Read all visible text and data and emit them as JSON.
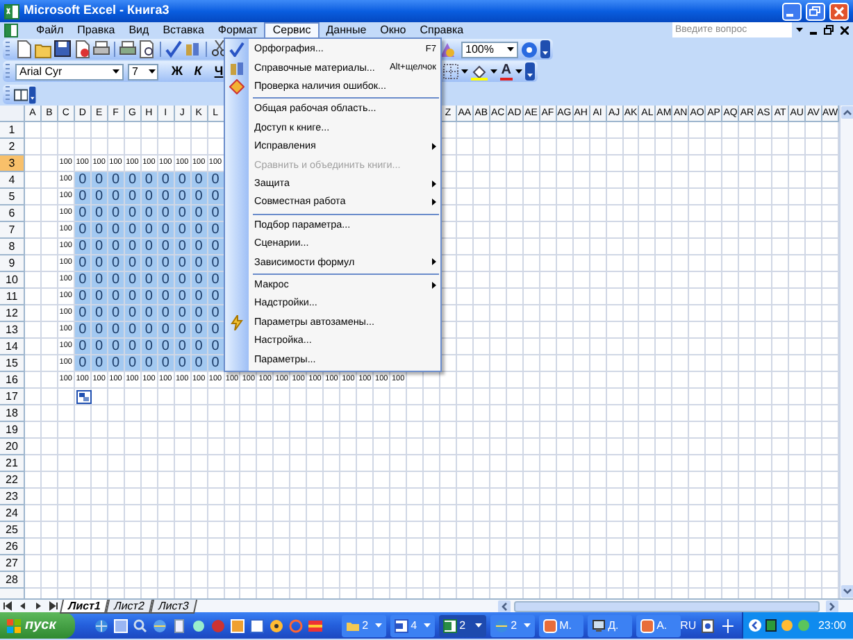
{
  "window": {
    "title": "Microsoft Excel - Книга3"
  },
  "menu_bar": [
    {
      "label": "Файл",
      "selected": false
    },
    {
      "label": "Правка",
      "selected": false
    },
    {
      "label": "Вид",
      "selected": false
    },
    {
      "label": "Вставка",
      "selected": false
    },
    {
      "label": "Формат",
      "selected": false
    },
    {
      "label": "Сервис",
      "selected": true
    },
    {
      "label": "Данные",
      "selected": false
    },
    {
      "label": "Окно",
      "selected": false
    },
    {
      "label": "Справка",
      "selected": false
    }
  ],
  "help_search": {
    "placeholder": "Введите вопрос"
  },
  "toolbar": {
    "zoom": "100%",
    "font": "Arial Cyr",
    "font_size": "7",
    "bold": "Ж",
    "italic": "К",
    "underline": "Ч",
    "font_color": "A"
  },
  "menu": [
    {
      "kind": "item",
      "label": "Орфография...",
      "shortcut": "F7",
      "submenu": false,
      "disabled": false
    },
    {
      "kind": "item",
      "label": "Справочные материалы...",
      "shortcut": "Alt+щелчок",
      "submenu": false,
      "disabled": false
    },
    {
      "kind": "item",
      "label": "Проверка наличия ошибок...",
      "submenu": false,
      "disabled": false
    },
    {
      "kind": "separator"
    },
    {
      "kind": "item",
      "label": "Общая рабочая область...",
      "submenu": false,
      "disabled": false
    },
    {
      "kind": "item",
      "label": "Доступ к книге...",
      "submenu": false,
      "disabled": false
    },
    {
      "kind": "item",
      "label": "Исправления",
      "submenu": true,
      "disabled": false
    },
    {
      "kind": "item",
      "label": "Сравнить и объединить книги...",
      "submenu": false,
      "disabled": true
    },
    {
      "kind": "item",
      "label": "Защита",
      "submenu": true,
      "disabled": false
    },
    {
      "kind": "item",
      "label": "Совместная работа",
      "submenu": true,
      "disabled": false
    },
    {
      "kind": "separator"
    },
    {
      "kind": "item",
      "label": "Подбор параметра...",
      "submenu": false,
      "disabled": false
    },
    {
      "kind": "item",
      "label": "Сценарии...",
      "submenu": false,
      "disabled": false
    },
    {
      "kind": "item",
      "label": "Зависимости формул",
      "submenu": true,
      "disabled": false
    },
    {
      "kind": "separator"
    },
    {
      "kind": "item",
      "label": "Макрос",
      "submenu": true,
      "disabled": false
    },
    {
      "kind": "item",
      "label": "Надстройки...",
      "submenu": false,
      "disabled": false
    },
    {
      "kind": "item",
      "label": "Параметры автозамены...",
      "submenu": false,
      "disabled": false
    },
    {
      "kind": "item",
      "label": "Настройка...",
      "submenu": false,
      "disabled": false
    },
    {
      "kind": "item",
      "label": "Параметры...",
      "submenu": false,
      "disabled": false
    }
  ],
  "sheet": {
    "columns_left": [
      "A",
      "B",
      "C",
      "D",
      "E",
      "F",
      "G",
      "H",
      "I",
      "J",
      "K",
      "L"
    ],
    "columns_right": [
      "Z",
      "AA",
      "AB",
      "AC",
      "AD",
      "AE",
      "AF",
      "AG",
      "AH",
      "AI",
      "AJ",
      "AK",
      "AL",
      "AM",
      "AN",
      "AO",
      "AP",
      "AQ",
      "AR",
      "AS",
      "AT",
      "AU",
      "AV",
      "AW"
    ],
    "rows": [
      {
        "number": "1",
        "selected": false
      },
      {
        "number": "2",
        "selected": false
      },
      {
        "number": "3",
        "selected": true,
        "cells": [
          {
            "text": "100",
            "selected": false
          },
          {
            "text": "100",
            "selected": false
          },
          {
            "text": "100",
            "selected": false
          },
          {
            "text": "100",
            "selected": false
          },
          {
            "text": "100",
            "selected": false
          },
          {
            "text": "100",
            "selected": false
          },
          {
            "text": "100",
            "selected": false
          },
          {
            "text": "100",
            "selected": false
          },
          {
            "text": "100",
            "selected": false
          },
          {
            "text": "100",
            "selected": false
          }
        ]
      },
      {
        "number": "4",
        "selected": false,
        "cells": [
          {
            "text": "100",
            "selected": false
          },
          {
            "text": "0",
            "selected": true
          },
          {
            "text": "0",
            "selected": true
          },
          {
            "text": "0",
            "selected": true
          },
          {
            "text": "0",
            "selected": true
          },
          {
            "text": "0",
            "selected": true
          },
          {
            "text": "0",
            "selected": true
          },
          {
            "text": "0",
            "selected": true
          },
          {
            "text": "0",
            "selected": true
          },
          {
            "text": "0",
            "selected": true
          }
        ]
      },
      {
        "number": "5",
        "selected": false,
        "cells": [
          {
            "text": "100",
            "selected": false
          },
          {
            "text": "0",
            "selected": true
          },
          {
            "text": "0",
            "selected": true
          },
          {
            "text": "0",
            "selected": true
          },
          {
            "text": "0",
            "selected": true
          },
          {
            "text": "0",
            "selected": true
          },
          {
            "text": "0",
            "selected": true
          },
          {
            "text": "0",
            "selected": true
          },
          {
            "text": "0",
            "selected": true
          },
          {
            "text": "0",
            "selected": true
          }
        ]
      },
      {
        "number": "6",
        "selected": false,
        "cells": [
          {
            "text": "100",
            "selected": false
          },
          {
            "text": "0",
            "selected": true
          },
          {
            "text": "0",
            "selected": true
          },
          {
            "text": "0",
            "selected": true
          },
          {
            "text": "0",
            "selected": true
          },
          {
            "text": "0",
            "selected": true
          },
          {
            "text": "0",
            "selected": true
          },
          {
            "text": "0",
            "selected": true
          },
          {
            "text": "0",
            "selected": true
          },
          {
            "text": "0",
            "selected": true
          }
        ]
      },
      {
        "number": "7",
        "selected": false,
        "cells": [
          {
            "text": "100",
            "selected": false
          },
          {
            "text": "0",
            "selected": true
          },
          {
            "text": "0",
            "selected": true
          },
          {
            "text": "0",
            "selected": true
          },
          {
            "text": "0",
            "selected": true
          },
          {
            "text": "0",
            "selected": true
          },
          {
            "text": "0",
            "selected": true
          },
          {
            "text": "0",
            "selected": true
          },
          {
            "text": "0",
            "selected": true
          },
          {
            "text": "0",
            "selected": true
          }
        ]
      },
      {
        "number": "8",
        "selected": false,
        "cells": [
          {
            "text": "100",
            "selected": false
          },
          {
            "text": "0",
            "selected": true
          },
          {
            "text": "0",
            "selected": true
          },
          {
            "text": "0",
            "selected": true
          },
          {
            "text": "0",
            "selected": true
          },
          {
            "text": "0",
            "selected": true
          },
          {
            "text": "0",
            "selected": true
          },
          {
            "text": "0",
            "selected": true
          },
          {
            "text": "0",
            "selected": true
          },
          {
            "text": "0",
            "selected": true
          }
        ]
      },
      {
        "number": "9",
        "selected": false,
        "cells": [
          {
            "text": "100",
            "selected": false
          },
          {
            "text": "0",
            "selected": true
          },
          {
            "text": "0",
            "selected": true
          },
          {
            "text": "0",
            "selected": true
          },
          {
            "text": "0",
            "selected": true
          },
          {
            "text": "0",
            "selected": true
          },
          {
            "text": "0",
            "selected": true
          },
          {
            "text": "0",
            "selected": true
          },
          {
            "text": "0",
            "selected": true
          },
          {
            "text": "0",
            "selected": true
          }
        ]
      },
      {
        "number": "10",
        "selected": false,
        "cells": [
          {
            "text": "100",
            "selected": false
          },
          {
            "text": "0",
            "selected": true
          },
          {
            "text": "0",
            "selected": true
          },
          {
            "text": "0",
            "selected": true
          },
          {
            "text": "0",
            "selected": true
          },
          {
            "text": "0",
            "selected": true
          },
          {
            "text": "0",
            "selected": true
          },
          {
            "text": "0",
            "selected": true
          },
          {
            "text": "0",
            "selected": true
          },
          {
            "text": "0",
            "selected": true
          }
        ]
      },
      {
        "number": "11",
        "selected": false,
        "cells": [
          {
            "text": "100",
            "selected": false
          },
          {
            "text": "0",
            "selected": true
          },
          {
            "text": "0",
            "selected": true
          },
          {
            "text": "0",
            "selected": true
          },
          {
            "text": "0",
            "selected": true
          },
          {
            "text": "0",
            "selected": true
          },
          {
            "text": "0",
            "selected": true
          },
          {
            "text": "0",
            "selected": true
          },
          {
            "text": "0",
            "selected": true
          },
          {
            "text": "0",
            "selected": true
          }
        ]
      },
      {
        "number": "12",
        "selected": false,
        "cells": [
          {
            "text": "100",
            "selected": false
          },
          {
            "text": "0",
            "selected": true
          },
          {
            "text": "0",
            "selected": true
          },
          {
            "text": "0",
            "selected": true
          },
          {
            "text": "0",
            "selected": true
          },
          {
            "text": "0",
            "selected": true
          },
          {
            "text": "0",
            "selected": true
          },
          {
            "text": "0",
            "selected": true
          },
          {
            "text": "0",
            "selected": true
          },
          {
            "text": "0",
            "selected": true
          }
        ]
      },
      {
        "number": "13",
        "selected": false,
        "cells": [
          {
            "text": "100",
            "selected": false
          },
          {
            "text": "0",
            "selected": true
          },
          {
            "text": "0",
            "selected": true
          },
          {
            "text": "0",
            "selected": true
          },
          {
            "text": "0",
            "selected": true
          },
          {
            "text": "0",
            "selected": true
          },
          {
            "text": "0",
            "selected": true
          },
          {
            "text": "0",
            "selected": true
          },
          {
            "text": "0",
            "selected": true
          },
          {
            "text": "0",
            "selected": true
          }
        ]
      },
      {
        "number": "14",
        "selected": false,
        "cells": [
          {
            "text": "100",
            "selected": false
          },
          {
            "text": "0",
            "selected": true
          },
          {
            "text": "0",
            "selected": true
          },
          {
            "text": "0",
            "selected": true
          },
          {
            "text": "0",
            "selected": true
          },
          {
            "text": "0",
            "selected": true
          },
          {
            "text": "0",
            "selected": true
          },
          {
            "text": "0",
            "selected": true
          },
          {
            "text": "0",
            "selected": true
          },
          {
            "text": "0",
            "selected": true
          }
        ]
      },
      {
        "number": "15",
        "selected": false,
        "cells": [
          {
            "text": "100",
            "selected": false
          },
          {
            "text": "0",
            "selected": true
          },
          {
            "text": "0",
            "selected": true
          },
          {
            "text": "0",
            "selected": true
          },
          {
            "text": "0",
            "selected": true
          },
          {
            "text": "0",
            "selected": true
          },
          {
            "text": "0",
            "selected": true
          },
          {
            "text": "0",
            "selected": true
          },
          {
            "text": "0",
            "selected": true
          },
          {
            "text": "0",
            "selected": true
          }
        ]
      },
      {
        "number": "16",
        "selected": false,
        "cells": [
          {
            "text": "100",
            "selected": false
          },
          {
            "text": "100",
            "selected": false
          },
          {
            "text": "100",
            "selected": false
          },
          {
            "text": "100",
            "selected": false
          },
          {
            "text": "100",
            "selected": false
          },
          {
            "text": "100",
            "selected": false
          },
          {
            "text": "100",
            "selected": false
          },
          {
            "text": "100",
            "selected": false
          },
          {
            "text": "100",
            "selected": false
          },
          {
            "text": "100",
            "selected": false
          },
          {
            "text": "100",
            "selected": false
          },
          {
            "text": "100",
            "selected": false
          },
          {
            "text": "100",
            "selected": false
          },
          {
            "text": "100",
            "selected": false
          },
          {
            "text": "100",
            "selected": false
          },
          {
            "text": "100",
            "selected": false
          },
          {
            "text": "100",
            "selected": false
          },
          {
            "text": "100",
            "selected": false
          },
          {
            "text": "100",
            "selected": false
          },
          {
            "text": "100",
            "selected": false
          },
          {
            "text": "100",
            "selected": false
          }
        ]
      },
      {
        "number": "17",
        "selected": false
      },
      {
        "number": "18",
        "selected": false
      },
      {
        "number": "19",
        "selected": false
      },
      {
        "number": "20",
        "selected": false
      },
      {
        "number": "21",
        "selected": false
      },
      {
        "number": "22",
        "selected": false
      },
      {
        "number": "23",
        "selected": false
      },
      {
        "number": "24",
        "selected": false
      },
      {
        "number": "25",
        "selected": false
      },
      {
        "number": "26",
        "selected": false
      },
      {
        "number": "27",
        "selected": false
      },
      {
        "number": "28",
        "selected": false
      }
    ]
  },
  "sheet_tabs": [
    {
      "label": "Лист1",
      "selected": true
    },
    {
      "label": "Лист2",
      "selected": false
    },
    {
      "label": "Лист3",
      "selected": false
    }
  ],
  "taskbar": {
    "start": "пуск",
    "tasks": [
      {
        "kind": "folder",
        "label": "2",
        "selected": false
      },
      {
        "kind": "word",
        "label": "4",
        "selected": false
      },
      {
        "kind": "excel",
        "label": "2",
        "selected": true
      },
      {
        "kind": "browser",
        "label": "2",
        "selected": false
      },
      {
        "kind": "app",
        "label": "М.",
        "selected": false
      },
      {
        "kind": "computer",
        "label": "Д.",
        "selected": false
      },
      {
        "kind": "app",
        "label": "А.",
        "selected": false
      }
    ],
    "language": "RU",
    "clock": "23:00"
  }
}
